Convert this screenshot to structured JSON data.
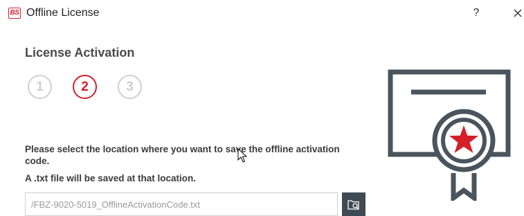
{
  "window": {
    "logo_text": "BS",
    "title": "Offline License",
    "help_label": "?"
  },
  "main": {
    "section_title": "License Activation",
    "steps": [
      {
        "label": "1",
        "state": "inactive"
      },
      {
        "label": "2",
        "state": "active"
      },
      {
        "label": "3",
        "state": "inactive"
      }
    ],
    "instruction": "Please select the location where you want to save the offline activation code.",
    "note": "A .txt file will be saved at that location.",
    "path_value": "/FBZ-9020-5019_OfflineActivationCode.txt",
    "browse_icon": "folder-search-icon"
  },
  "colors": {
    "accent": "#d3202a",
    "inactive": "#cfcfcf",
    "dark": "#404a52",
    "text": "#3a3a3a"
  },
  "icons": {
    "certificate": "certificate-icon"
  }
}
